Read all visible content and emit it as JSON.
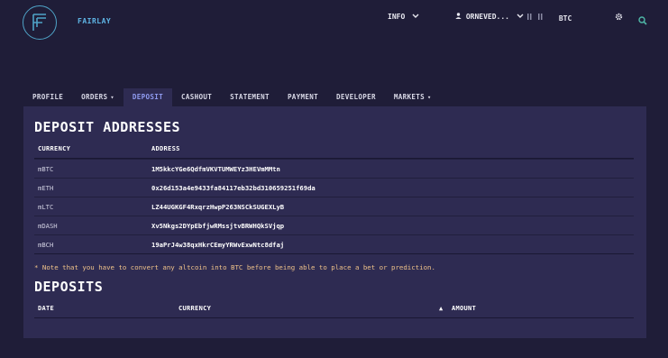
{
  "header": {
    "brand": "FAIRLAY",
    "info_label": "INFO",
    "user_label": "ORNEVED...",
    "currency_label": "BTC",
    "icons": [
      "logo-icon",
      "user-icon",
      "wallet-icon",
      "gear-icon",
      "search-icon"
    ]
  },
  "tabs": [
    {
      "label": "PROFILE"
    },
    {
      "label": "ORDERS"
    },
    {
      "label": "DEPOSIT"
    },
    {
      "label": "CASHOUT"
    },
    {
      "label": "STATEMENT"
    },
    {
      "label": "PAYMENT"
    },
    {
      "label": "DEVELOPER"
    },
    {
      "label": "MARKETS"
    }
  ],
  "active_tab": "DEPOSIT",
  "deposit_addresses": {
    "title": "DEPOSIT ADDRESSES",
    "columns": [
      "CURRENCY",
      "ADDRESS"
    ],
    "rows": [
      {
        "currency": "mBTC",
        "address": "1M5kkcYGe6QdfmVKVTUMWEYz3HEVmMMtn"
      },
      {
        "currency": "mETH",
        "address": "0x26d153a4e9433fa84117eb32bd310659251f69da"
      },
      {
        "currency": "mLTC",
        "address": "LZ44UGKGF4RxqrzHwpP263NSCkSUGEXLyB"
      },
      {
        "currency": "mDASH",
        "address": "Xv5Nkgs2DYpEbfjwRMssjtvBRWHQkSVjqp"
      },
      {
        "currency": "mBCH",
        "address": "19aPrJ4w38qxHkrCEmyYRWvExwNtc8dfaj"
      }
    ],
    "note": "* Note that you have to convert any altcoin into BTC before being able to place a bet or prediction."
  },
  "deposits": {
    "title": "DEPOSITS",
    "columns": [
      "DATE",
      "CURRENCY",
      "AMOUNT"
    ],
    "sort_indicator": "▲"
  },
  "colors": {
    "background": "#1f1d38",
    "panel": "#2e2b52",
    "accent": "#8f9aef",
    "brand": "#5fb6e6",
    "note": "#f0c38a"
  }
}
